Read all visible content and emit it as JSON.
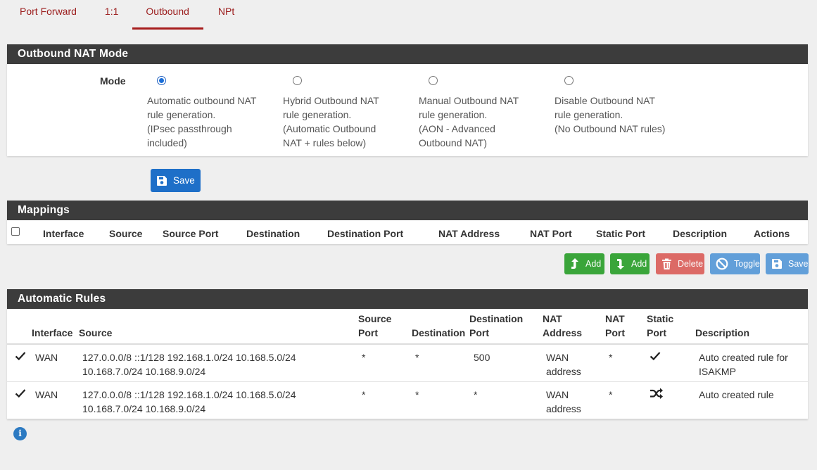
{
  "tabs": [
    {
      "label": "Port Forward",
      "active": false
    },
    {
      "label": "1:1",
      "active": false
    },
    {
      "label": "Outbound",
      "active": true
    },
    {
      "label": "NPt",
      "active": false
    }
  ],
  "mode_panel": {
    "title": "Outbound NAT Mode",
    "mode_label": "Mode",
    "options": [
      {
        "desc": "Automatic outbound NAT\nrule generation.\n(IPsec passthrough\nincluded)",
        "checked": true
      },
      {
        "desc": "Hybrid Outbound NAT\nrule generation.\n(Automatic Outbound\nNAT + rules below)",
        "checked": false
      },
      {
        "desc": "Manual Outbound NAT\nrule generation.\n(AON - Advanced\nOutbound NAT)",
        "checked": false
      },
      {
        "desc": "Disable Outbound NAT\nrule generation.\n(No Outbound NAT rules)",
        "checked": false
      }
    ],
    "save_label": "Save"
  },
  "mappings": {
    "title": "Mappings",
    "columns": [
      "Interface",
      "Source",
      "Source Port",
      "Destination",
      "Destination Port",
      "NAT Address",
      "NAT Port",
      "Static Port",
      "Description",
      "Actions"
    ],
    "buttons": {
      "add_top": "Add",
      "add_bottom": "Add",
      "delete": "Delete",
      "toggle": "Toggle",
      "save": "Save"
    }
  },
  "auto_rules": {
    "title": "Automatic Rules",
    "columns": [
      "Interface",
      "Source",
      "Source\nPort",
      "Destination",
      "Destination\nPort",
      "NAT\nAddress",
      "NAT\nPort",
      "Static\nPort",
      "Description"
    ],
    "rows": [
      {
        "enabled_icon": "check-icon",
        "interface": "WAN",
        "source": "127.0.0.0/8 ::1/128 192.168.1.0/24 10.168.5.0/24\n10.168.7.0/24 10.168.9.0/24",
        "source_port": "*",
        "destination": "*",
        "destination_port": "500",
        "nat_address": "WAN\naddress",
        "nat_port": "*",
        "static_port_icon": "check-icon",
        "description": "Auto created rule for\nISAKMP"
      },
      {
        "enabled_icon": "check-icon",
        "interface": "WAN",
        "source": "127.0.0.0/8 ::1/128 192.168.1.0/24 10.168.5.0/24\n10.168.7.0/24 10.168.9.0/24",
        "source_port": "*",
        "destination": "*",
        "destination_port": "*",
        "nat_address": "WAN\naddress",
        "nat_port": "*",
        "static_port_icon": "shuffle-icon",
        "description": "Auto created rule"
      }
    ]
  },
  "info_icon": "info-icon",
  "colors": {
    "accent": "#9b1c1c",
    "heading_bg": "#3c3c3c",
    "primary": "#1e6fc8",
    "success": "#3aa53a",
    "danger": "#d9534f",
    "info": "#5b9bd8"
  }
}
